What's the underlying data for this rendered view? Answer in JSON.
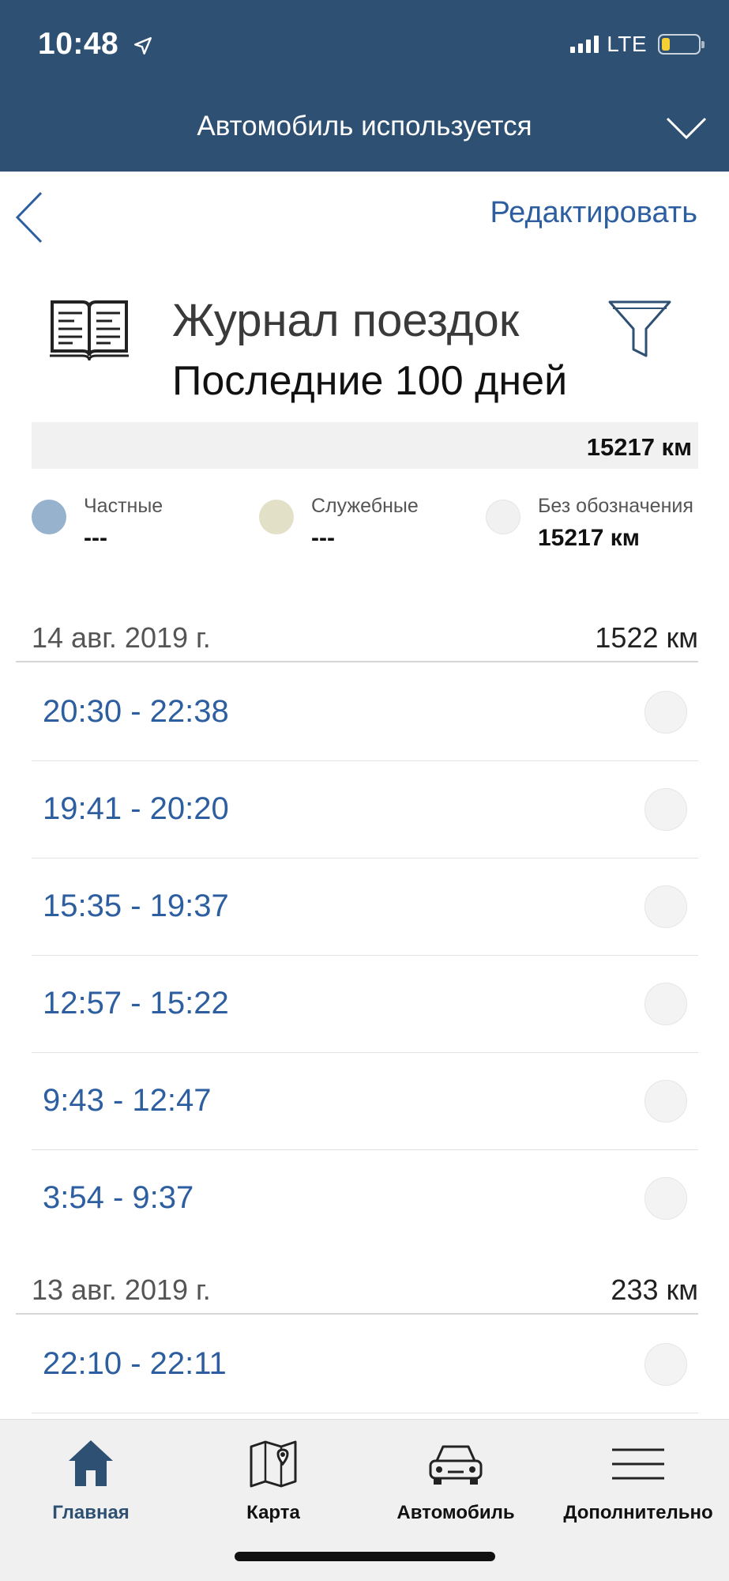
{
  "status_bar": {
    "time": "10:48",
    "network": "LTE"
  },
  "car_status": {
    "label": "Автомобиль используется"
  },
  "nav": {
    "edit_label": "Редактировать"
  },
  "title": {
    "main": "Журнал поездок",
    "period": "Последние 100 дней"
  },
  "total": {
    "km": "15217 км"
  },
  "legend": [
    {
      "label": "Частные",
      "value": "---",
      "color": "#96b2cd"
    },
    {
      "label": "Служебные",
      "value": "---",
      "color": "#e3e0c8"
    },
    {
      "label": "Без обозначения",
      "value": "15217 км",
      "color": "#f1f1f1"
    }
  ],
  "days": [
    {
      "date": "14 авг. 2019 г.",
      "km": "1522 км",
      "trips": [
        "20:30 - 22:38",
        "19:41 - 20:20",
        "15:35 - 19:37",
        "12:57 - 15:22",
        "9:43 - 12:47",
        "3:54 - 9:37"
      ]
    },
    {
      "date": "13 авг. 2019 г.",
      "km": "233 км",
      "trips": [
        "22:10 - 22:11"
      ]
    }
  ],
  "tabbar": [
    {
      "label": "Главная",
      "icon": "home-icon",
      "active": true
    },
    {
      "label": "Карта",
      "icon": "map-icon",
      "active": false
    },
    {
      "label": "Автомобиль",
      "icon": "car-icon",
      "active": false
    },
    {
      "label": "Дополнительно",
      "icon": "menu-icon",
      "active": false
    }
  ],
  "colors": {
    "header_bg": "#2e5073",
    "accent": "#2d5fa0",
    "tabbar_bg": "#f0f0f0"
  }
}
